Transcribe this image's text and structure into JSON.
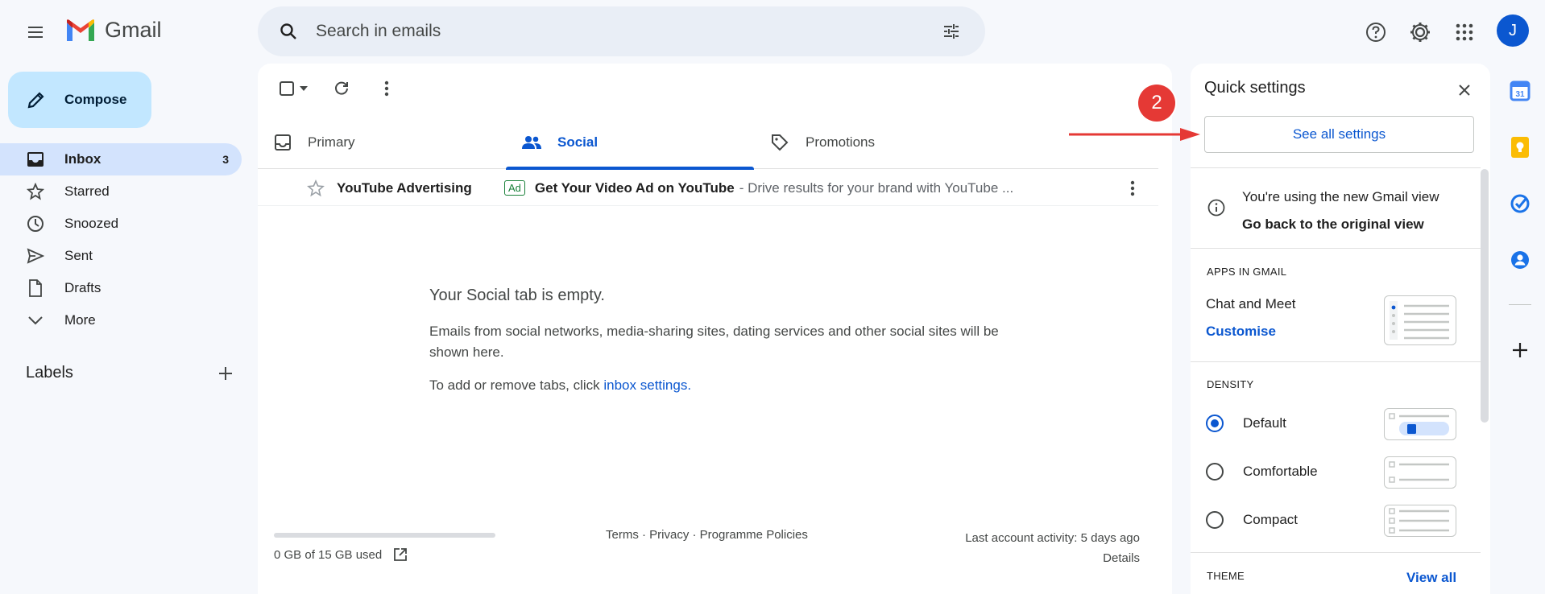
{
  "header": {
    "app_name": "Gmail",
    "search_placeholder": "Search in emails",
    "avatar_letter": "J"
  },
  "sidebar": {
    "compose_label": "Compose",
    "items": [
      {
        "label": "Inbox",
        "count": "3",
        "icon": "inbox-icon"
      },
      {
        "label": "Starred",
        "count": "",
        "icon": "star-icon"
      },
      {
        "label": "Snoozed",
        "count": "",
        "icon": "clock-icon"
      },
      {
        "label": "Sent",
        "count": "",
        "icon": "send-icon"
      },
      {
        "label": "Drafts",
        "count": "",
        "icon": "draft-icon"
      },
      {
        "label": "More",
        "count": "",
        "icon": "chevron-down-icon"
      }
    ],
    "labels_heading": "Labels"
  },
  "tabs": [
    {
      "label": "Primary",
      "active": false
    },
    {
      "label": "Social",
      "active": true
    },
    {
      "label": "Promotions",
      "active": false
    }
  ],
  "email": {
    "sender": "YouTube Advertising",
    "badge": "Ad",
    "subject": "Get Your Video Ad on YouTube",
    "snippet": "- Drive results for your brand with YouTube ..."
  },
  "empty_state": {
    "title": "Your Social tab is empty.",
    "body": "Emails from social networks, media-sharing sites, dating services and other social sites will be shown here.",
    "hint_prefix": "To add or remove tabs, click ",
    "hint_link": "inbox settings",
    "hint_suffix": "."
  },
  "footer": {
    "storage": "0 GB of 15 GB used",
    "storage_fraction": 0,
    "links": "Terms · Privacy · Programme Policies",
    "activity": "Last account activity: 5 days ago",
    "details": "Details"
  },
  "quick_settings": {
    "title": "Quick settings",
    "see_all": "See all settings",
    "new_view_text": "You're using the new Gmail view",
    "back_link": "Go back to the original view",
    "apps_label": "APPS IN GMAIL",
    "chat_meet": "Chat and Meet",
    "customise": "Customise",
    "density_label": "DENSITY",
    "density_options": [
      {
        "label": "Default",
        "selected": true
      },
      {
        "label": "Comfortable",
        "selected": false
      },
      {
        "label": "Compact",
        "selected": false
      }
    ],
    "theme_label": "THEME",
    "view_all": "View all"
  },
  "annotation": {
    "step_number": "2"
  },
  "colors": {
    "accent": "#0b57d0",
    "selected_nav": "#d3e3fd",
    "compose_bg": "#c2e7ff",
    "annotation_red": "#e53935"
  }
}
